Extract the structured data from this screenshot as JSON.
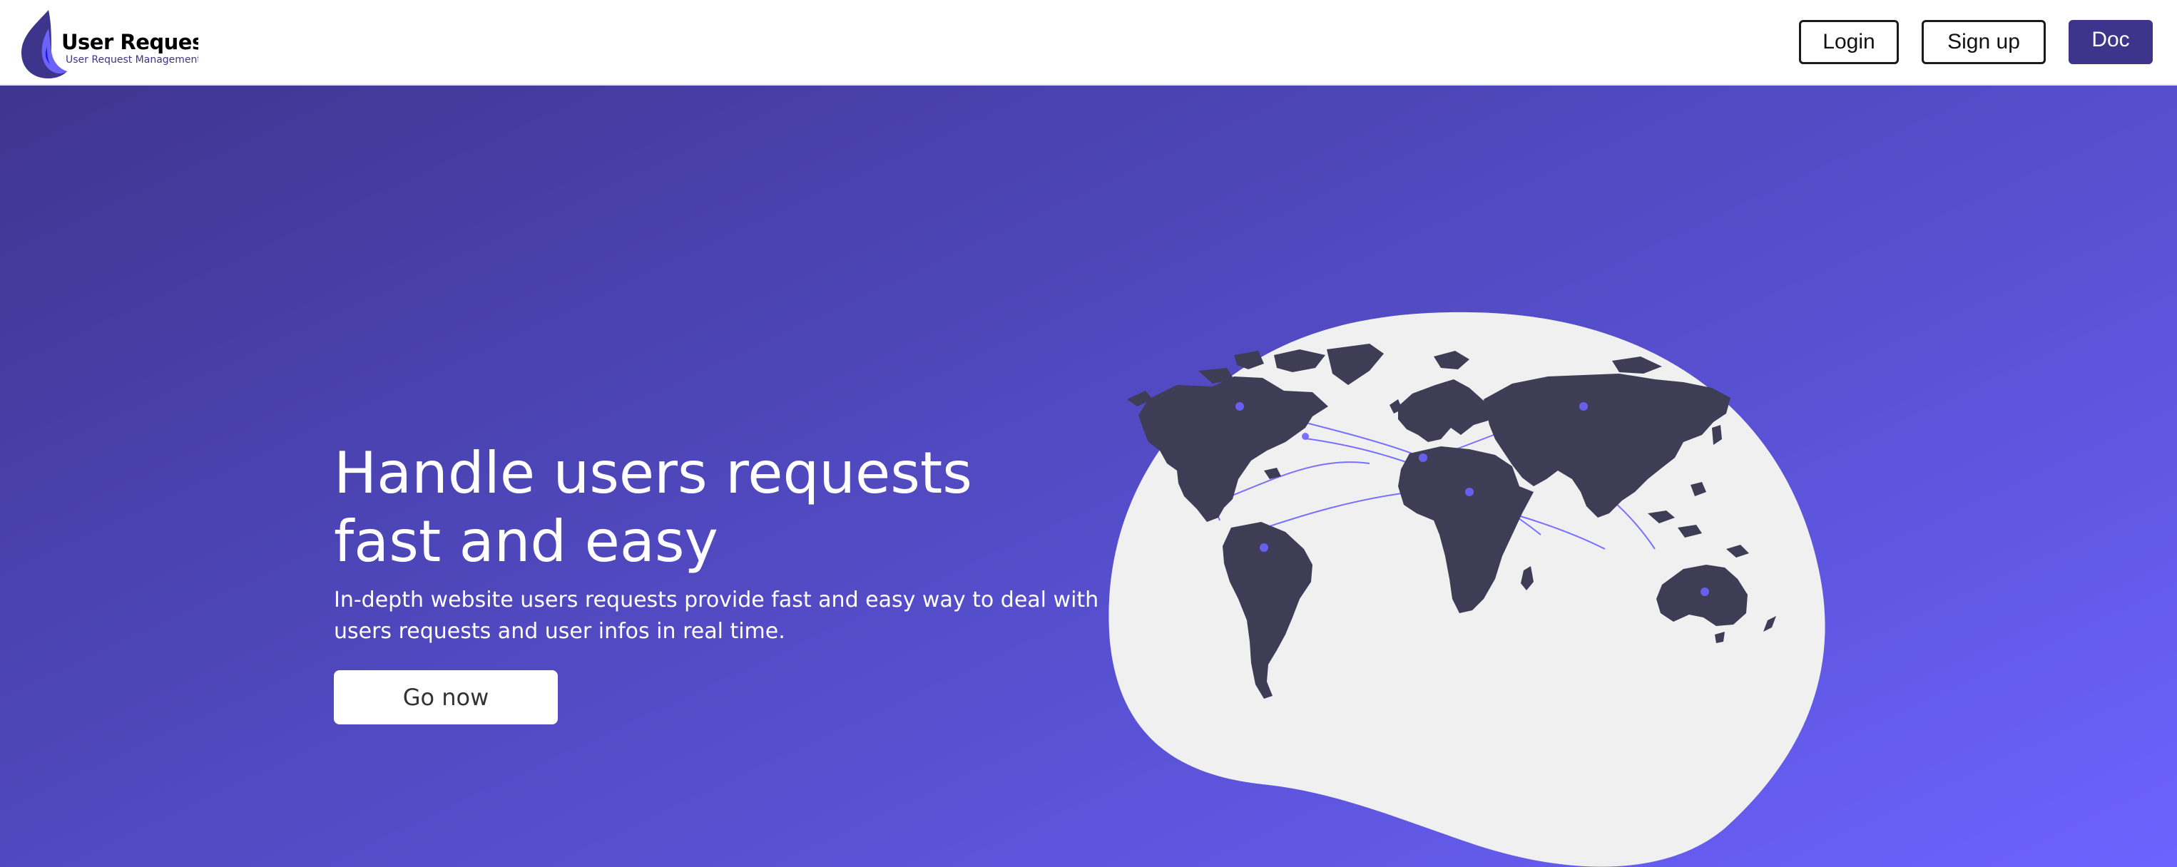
{
  "header": {
    "logo": {
      "title": "User Request",
      "subtitle": "User Request Management"
    },
    "nav": {
      "login_label": "Login",
      "signup_label": "Sign up",
      "doc_label": "Doc"
    }
  },
  "hero": {
    "title_line1": "Handle users requests",
    "title_line2": "fast and easy",
    "description": "In-depth website users requests provide fast and easy way to deal with users requests and user infos in real time.",
    "cta_label": "Go now"
  },
  "illustration": {
    "icon": "world-map-network"
  },
  "colors": {
    "brand": "#3d348b",
    "accent": "#6c63ff",
    "map_land": "#3f3d56",
    "blob": "#f0f0f0"
  }
}
